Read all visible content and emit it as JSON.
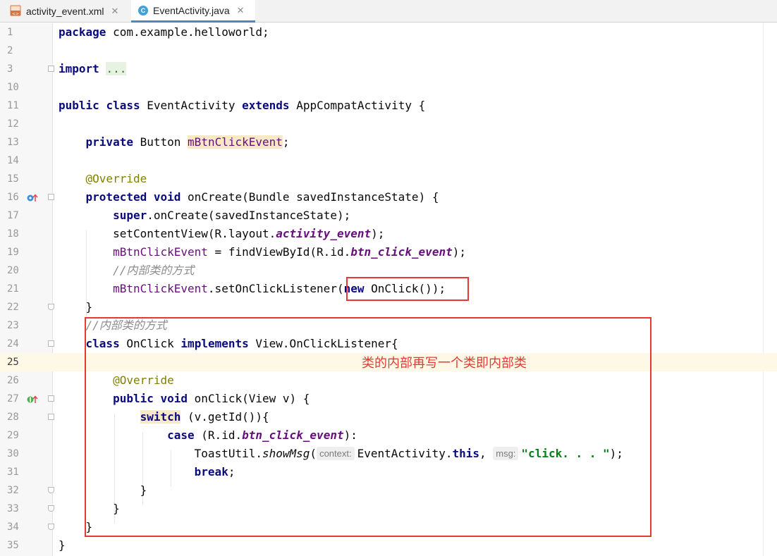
{
  "tabs": [
    {
      "label": "activity_event.xml",
      "icon": "xml-file-icon",
      "active": false
    },
    {
      "label": "EventActivity.java",
      "icon": "java-class-icon",
      "active": true
    }
  ],
  "annotation_note": "类的内部再写一个类即内部类",
  "lines": [
    {
      "n": "1"
    },
    {
      "n": "2"
    },
    {
      "n": "3"
    },
    {
      "n": "10"
    },
    {
      "n": "11"
    },
    {
      "n": "12"
    },
    {
      "n": "13"
    },
    {
      "n": "14"
    },
    {
      "n": "15"
    },
    {
      "n": "16"
    },
    {
      "n": "17"
    },
    {
      "n": "18"
    },
    {
      "n": "19"
    },
    {
      "n": "20"
    },
    {
      "n": "21"
    },
    {
      "n": "22"
    },
    {
      "n": "23"
    },
    {
      "n": "24"
    },
    {
      "n": "25"
    },
    {
      "n": "26"
    },
    {
      "n": "27"
    },
    {
      "n": "28"
    },
    {
      "n": "29"
    },
    {
      "n": "30"
    },
    {
      "n": "31"
    },
    {
      "n": "32"
    },
    {
      "n": "33"
    },
    {
      "n": "34"
    },
    {
      "n": "35"
    }
  ],
  "code": {
    "l1": {
      "kw": "package",
      "rest": " com.example.helloworld;"
    },
    "l3": {
      "kw": "import",
      "folded": "..."
    },
    "l11": {
      "kw1": "public",
      "kw2": "class",
      "name": "EventActivity",
      "kw3": "extends",
      "rest": "AppCompatActivity {"
    },
    "l13": {
      "kw": "private",
      "type": "Button",
      "field": "mBtnClickEvent",
      "semi": ";"
    },
    "l15": {
      "ann": "@Override"
    },
    "l16": {
      "kw1": "protected",
      "kw2": "void",
      "rest": "onCreate(Bundle savedInstanceState) {"
    },
    "l17": {
      "kw": "super",
      "rest": ".onCreate(savedInstanceState);"
    },
    "l18": {
      "pre": "setContentView(R.layout.",
      "stat": "activity_event",
      "post": ");"
    },
    "l19": {
      "field": "mBtnClickEvent",
      "pre": " = findViewById(R.id.",
      "stat": "btn_click_event",
      "post": ");"
    },
    "l20": {
      "comment": "//内部类的方式"
    },
    "l21": {
      "field": "mBtnClickEvent",
      "pre": ".setOnClickListener(",
      "kw": "new",
      "post": " OnClick());"
    },
    "l22": {
      "text": "}"
    },
    "l23": {
      "comment": "//内部类的方式"
    },
    "l24": {
      "kw1": "class",
      "name": "OnClick",
      "kw2": "implements",
      "rest": "View.OnClickListener{"
    },
    "l26": {
      "ann": "@Override"
    },
    "l27": {
      "kw1": "public",
      "kw2": "void",
      "rest": "onClick(View v) {"
    },
    "l28": {
      "kw": "switch",
      "rest": " (v.getId()){"
    },
    "l29": {
      "kw": "case",
      "pre": " (R.id.",
      "stat": "btn_click_event",
      "post": "):"
    },
    "l30": {
      "pre": "ToastUtil.",
      "method": "showMsg",
      "open": "(",
      "hint1": "context:",
      "arg1": "EventActivity.",
      "kw": "this",
      "comma": ", ",
      "hint2": "msg:",
      "str": "\"click. . . \"",
      "post": ");"
    },
    "l31": {
      "kw": "break",
      "post": ";"
    },
    "l32": {
      "text": "}"
    },
    "l33": {
      "text": "}"
    },
    "l34": {
      "text": "}"
    },
    "l35": {
      "text": "}"
    }
  }
}
